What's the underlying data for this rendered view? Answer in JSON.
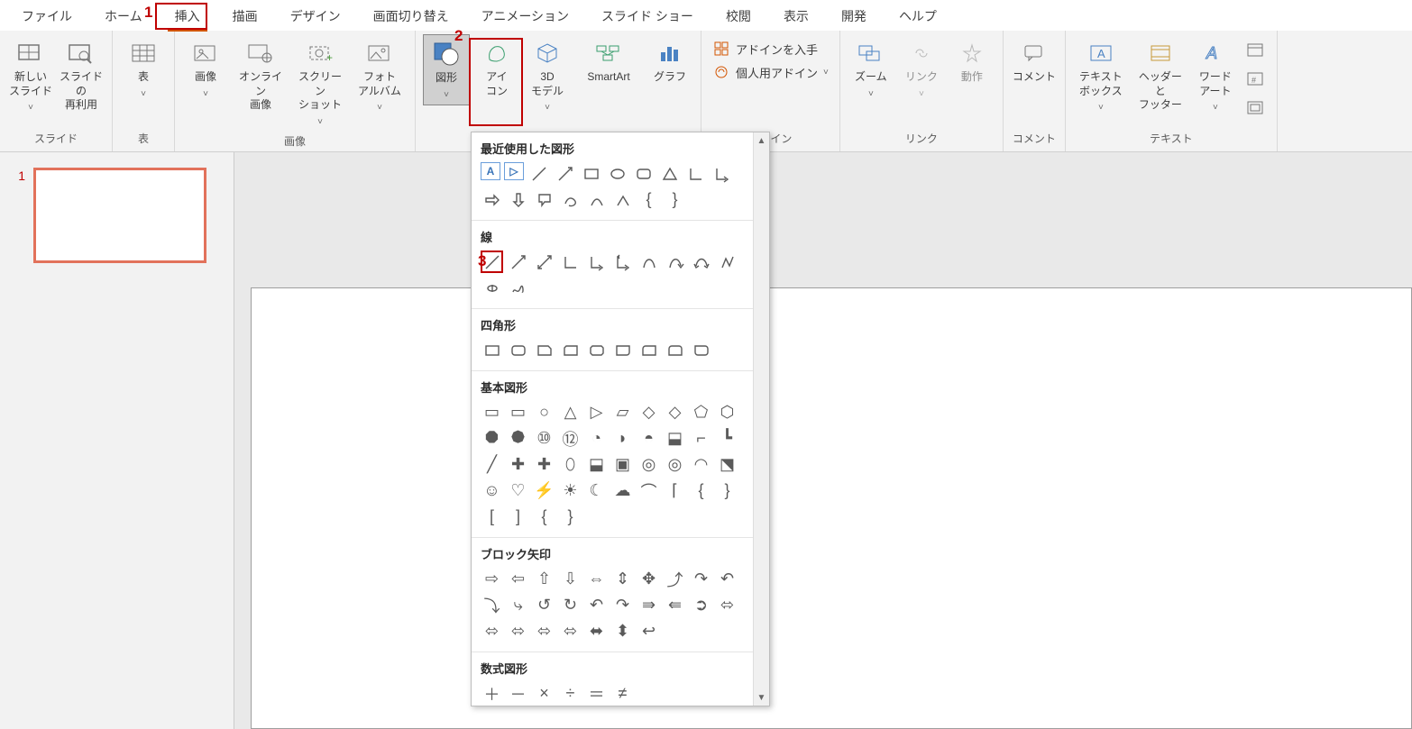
{
  "annotations": {
    "a1": "1",
    "a2": "2",
    "a3": "3"
  },
  "menu": {
    "file": "ファイル",
    "home": "ホーム",
    "insert": "挿入",
    "draw": "描画",
    "design": "デザイン",
    "transitions": "画面切り替え",
    "animations": "アニメーション",
    "slideshow": "スライド ショー",
    "review": "校閲",
    "view": "表示",
    "developer": "開発",
    "help": "ヘルプ"
  },
  "ribbon": {
    "groups": {
      "slides": "スライド",
      "tables": "表",
      "images": "画像",
      "addins": "アドイン",
      "links": "リンク",
      "comments": "コメント",
      "text": "テキスト"
    },
    "btn": {
      "new_slide": "新しい\nスライド",
      "reuse": "スライドの\n再利用",
      "table": "表",
      "pictures": "画像",
      "online_pic": "オンライン\n画像",
      "screenshot": "スクリーン\nショット",
      "photo_album": "フォト\nアルバム",
      "shapes": "図形",
      "icons": "アイ\nコン",
      "threeD": "3D\nモデル",
      "smartart": "SmartArt",
      "chart": "グラフ",
      "get_addins": "アドインを入手",
      "my_addins": "個人用アドイン",
      "zoom": "ズーム",
      "link": "リンク",
      "action": "動作",
      "comment": "コメント",
      "textbox": "テキスト\nボックス",
      "header_footer": "ヘッダーと\nフッター",
      "wordart": "ワード\nアート"
    }
  },
  "thumb": {
    "num": "1"
  },
  "shapes_popup": {
    "sections": {
      "recent": "最近使用した図形",
      "lines": "線",
      "rects": "四角形",
      "basic": "基本図形",
      "block_arrows": "ブロック矢印",
      "equation": "数式図形"
    }
  }
}
